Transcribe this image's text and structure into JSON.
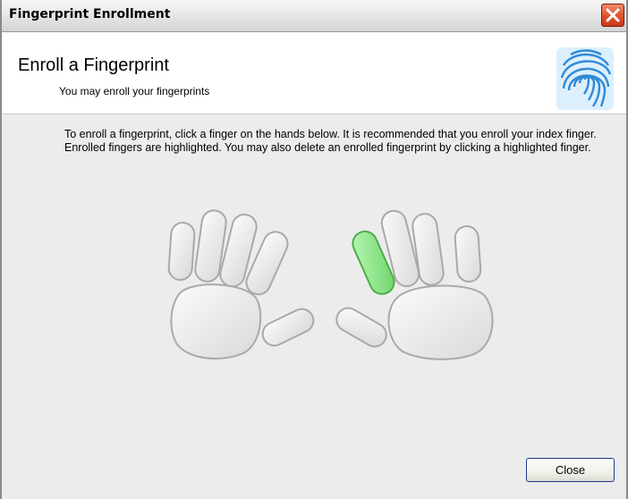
{
  "window": {
    "title": "Fingerprint Enrollment"
  },
  "header": {
    "title": "Enroll a Fingerprint",
    "subtitle": "You may enroll your fingerprints"
  },
  "instructions": "To enroll a fingerprint, click a finger on the hands below. It is recommended that you enroll your index finger. Enrolled fingers are highlighted. You may also delete an enrolled fingerprint by clicking a highlighted finger.",
  "hands": {
    "enrolled_finger": "right-index",
    "colors": {
      "finger": "#e8e8e8",
      "outline": "#a9a9a9",
      "enrolled": "#8ee88a",
      "enrolled_outline": "#4cae4a"
    }
  },
  "buttons": {
    "close": "Close"
  },
  "icons": {
    "title_close": "close-icon",
    "header_icon": "fingerprint-icon"
  }
}
